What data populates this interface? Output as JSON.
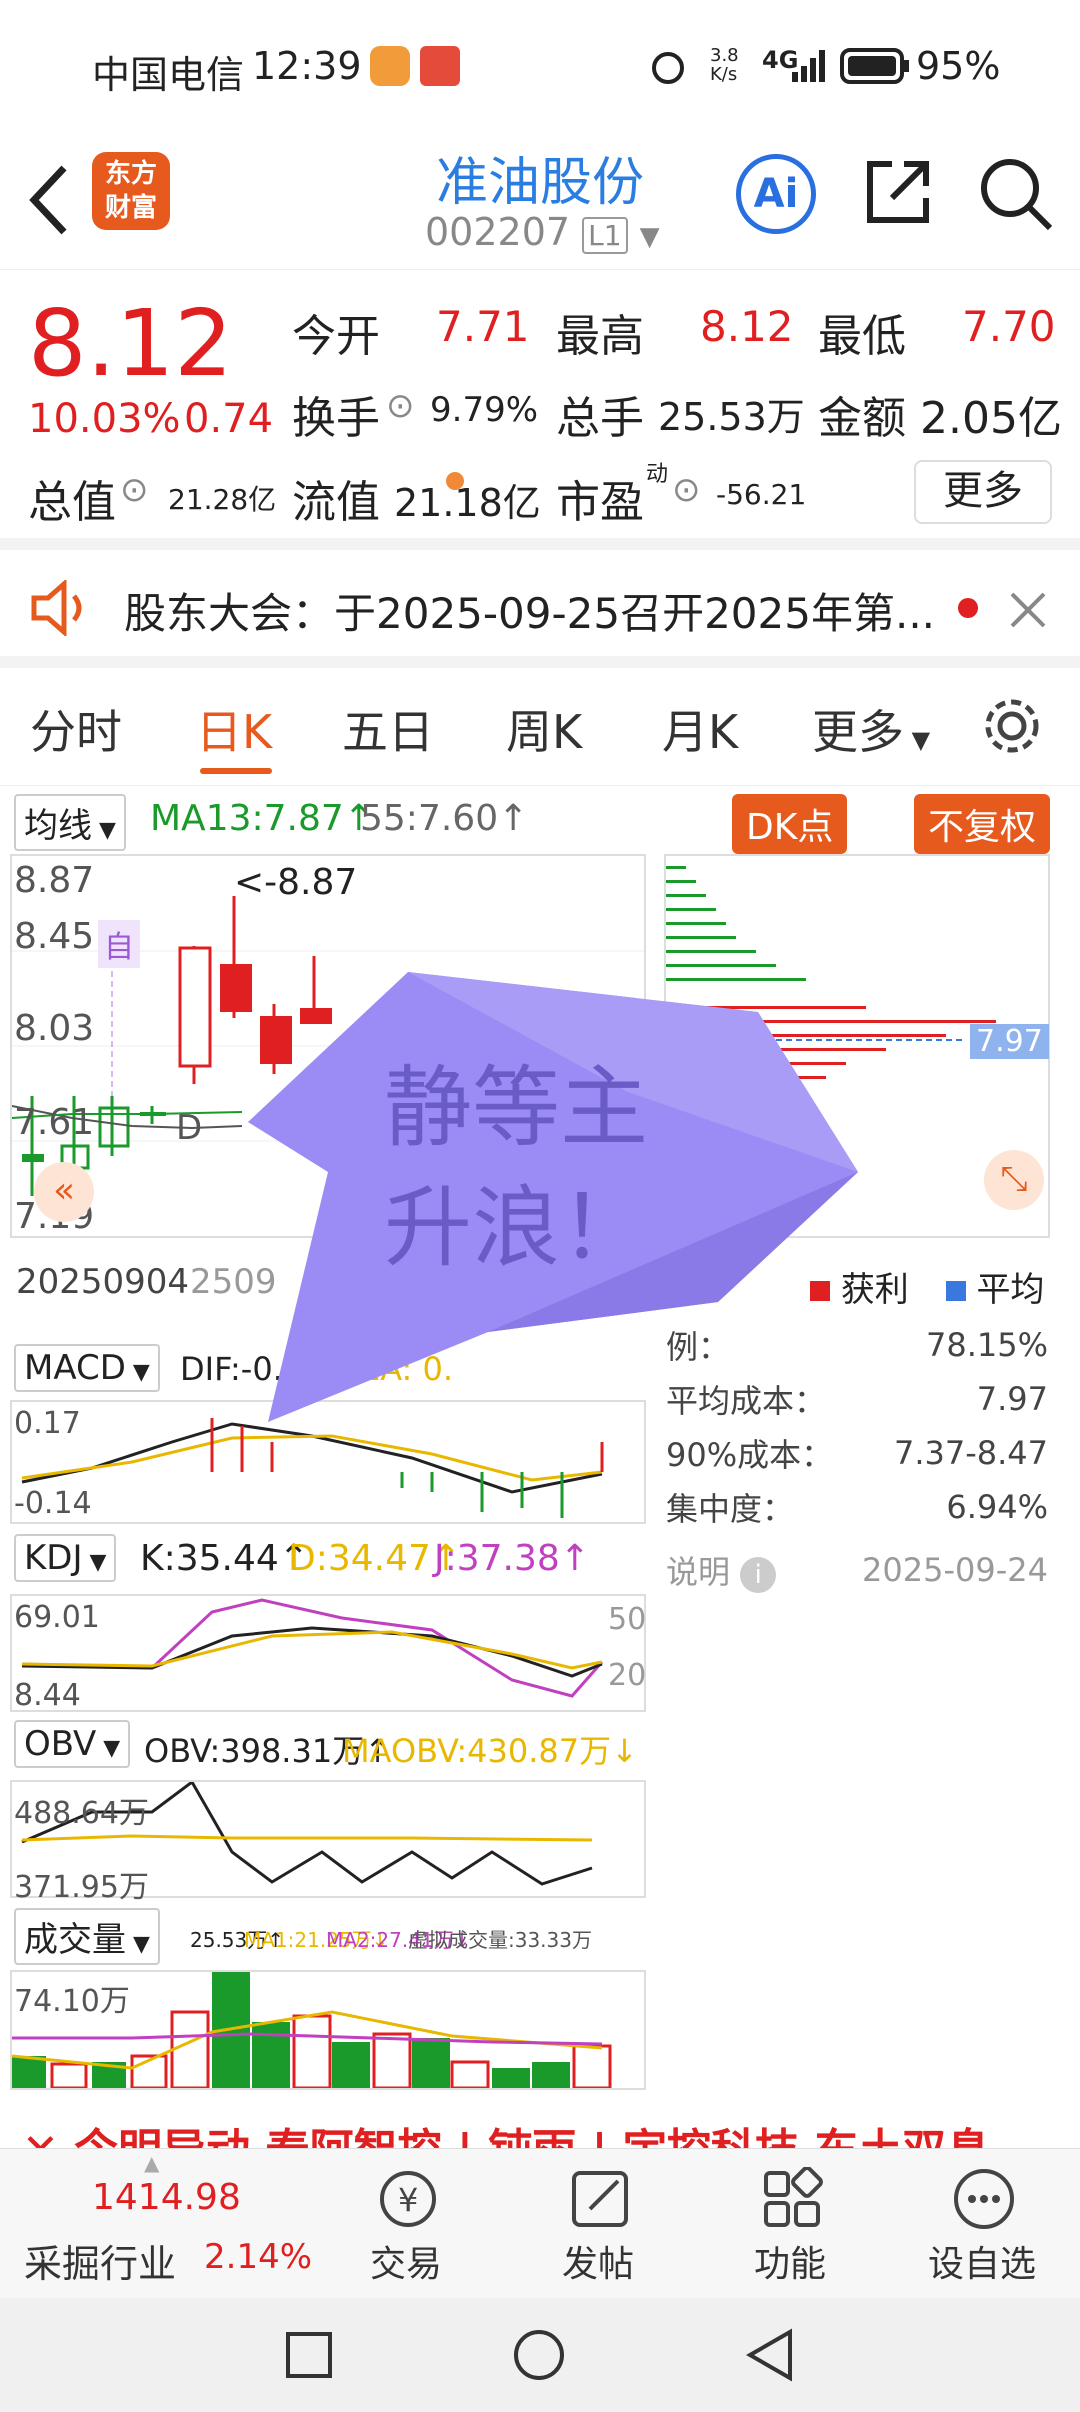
{
  "status": {
    "carrier": "中国电信",
    "time": "12:39",
    "net_speed_top": "3.8",
    "net_speed_bottom": "K/s",
    "network": "4G",
    "battery": "95%"
  },
  "header": {
    "logo_line1": "东方",
    "logo_line2": "财富",
    "stock_name": "准油股份",
    "stock_code": "002207",
    "level_badge": "L1",
    "ai_label": "Ai"
  },
  "quote": {
    "price": "8.12",
    "change_pct": "10.03%",
    "change_amt": "0.74",
    "open_label": "今开",
    "open": "7.71",
    "high_label": "最高",
    "high": "8.12",
    "low_label": "最低",
    "low": "7.70",
    "turnover_label": "换手",
    "turnover": "9.79%",
    "volume_label": "总手",
    "volume": "25.53万",
    "amount_label": "金额",
    "amount": "2.05亿",
    "mktcap_label": "总值",
    "mktcap": "21.28亿",
    "float_label": "流值",
    "float": "21.18亿",
    "pe_label": "市盈",
    "pe_sup": "动",
    "pe": "-56.21",
    "more_label": "更多"
  },
  "notice": {
    "text": "股东大会：于2025-09-25召开2025年第..."
  },
  "tabs": {
    "items": [
      "分时",
      "日K",
      "五日",
      "周K",
      "月K",
      "更多"
    ],
    "active": "日K"
  },
  "kchart": {
    "ma_select": "均线",
    "ma13": "MA13:7.87↑",
    "ma55": "55:7.60↑",
    "dk_label": "DK点",
    "fq_label": "不复权",
    "y_labels": [
      "8.87",
      "8.45",
      "8.03",
      "7.61",
      "7.19"
    ],
    "max_marker": "<-8.87",
    "self_marker": "自",
    "d_marker": "D",
    "date_left": "20250904",
    "date_right": "2509",
    "avg_marker": "7.97"
  },
  "sticker": {
    "line1": "静等主",
    "line2": "升浪！"
  },
  "chip": {
    "legend_profit": "获利",
    "legend_avg": "平均",
    "rows": [
      {
        "label": "例：",
        "value": "78.15%"
      },
      {
        "label": "平均成本：",
        "value": "7.97"
      },
      {
        "label": "90%成本：",
        "value": "7.37-8.47"
      },
      {
        "label": "集中度：",
        "value": "6.94%"
      }
    ],
    "note_label": "说明",
    "date": "2025-09-24"
  },
  "macd": {
    "select": "MACD",
    "dif": "DIF:-0.01",
    "dea": "EA: 0.",
    "y_top": "0.17",
    "y_bottom": "-0.14"
  },
  "kdj": {
    "select": "KDJ",
    "k": "K:35.44↑",
    "d": "D:34.47↑",
    "j": "J:37.38↑",
    "y_top": "69.01",
    "y_bottom": "8.44",
    "ref_top": "50",
    "ref_bottom": "20"
  },
  "obv": {
    "select": "OBV",
    "obv": "OBV:398.31万↑",
    "maobv": "MAOBV:430.87万↓",
    "y_top": "488.64万",
    "y_bottom": "371.95万"
  },
  "vol": {
    "select": "成交量",
    "v": "25.53万↑",
    "ma1": "MA1:21.25万↓",
    "ma2": "MA2:27.41万↓",
    "virtual": "虚拟成交量:33.33万",
    "y_top": "74.10万"
  },
  "ticker_strip": {
    "text": "✕ 今明异动 泰阿智控 | 钝雨 | 宇控科技 东土双息"
  },
  "bottombar": {
    "index_value": "1414.98",
    "index_name": "采掘行业",
    "index_pct": "2.14%",
    "trade": "交易",
    "post": "发帖",
    "func": "功能",
    "watch": "设自选"
  },
  "colors": {
    "accent": "#e65a1e",
    "rise": "#e02020",
    "fall": "#1a9a2a",
    "ma_yellow": "#e8b800",
    "ma_purple": "#c040c0",
    "sticker": "#9b8cf5"
  }
}
